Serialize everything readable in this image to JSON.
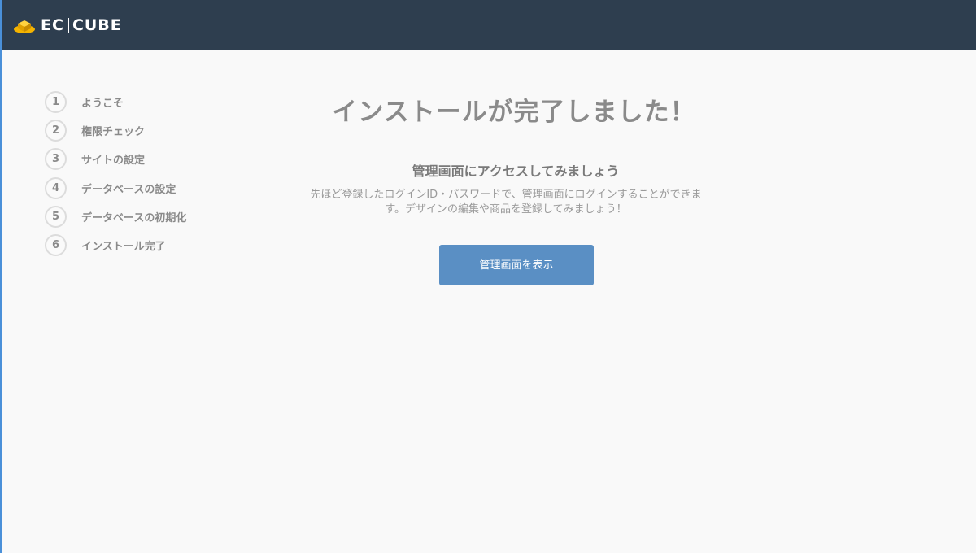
{
  "header": {
    "logo_left": "EC",
    "logo_right": "CUBE"
  },
  "steps": [
    {
      "num": "1",
      "label": "ようこそ"
    },
    {
      "num": "2",
      "label": "権限チェック"
    },
    {
      "num": "3",
      "label": "サイトの設定"
    },
    {
      "num": "4",
      "label": "データベースの設定"
    },
    {
      "num": "5",
      "label": "データベースの初期化"
    },
    {
      "num": "6",
      "label": "インストール完了"
    }
  ],
  "main": {
    "title": "インストールが完了しました！",
    "subtitle": "管理画面にアクセスしてみましょう",
    "description_line1": "先ほど登録したログインID・パスワードで、管理画面にログインすることができま",
    "description_line2": "す。デザインの編集や商品を登録してみましょう！",
    "button_label": "管理画面を表示"
  },
  "colors": {
    "header_bg": "#2e3e4f",
    "logo_accent": "#f5b400",
    "button_bg": "#5a8fc4",
    "page_bg": "#f9f9f9"
  }
}
